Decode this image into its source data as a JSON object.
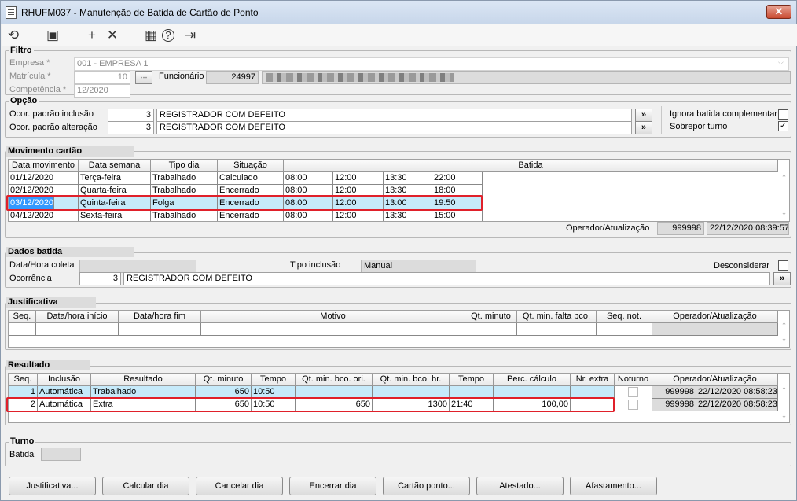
{
  "window": {
    "title": "RHUFM037 - Manutenção de Batida de Cartão de Ponto",
    "close_label": "✕"
  },
  "toolbar": {
    "refresh_icon": "⟲",
    "save_icon": "▣",
    "add_icon": "+",
    "delete_icon": "✕",
    "calendar_icon": "▦",
    "help_icon": "?",
    "exit_icon": "⇥"
  },
  "filtro": {
    "title": "Filtro",
    "empresa_label": "Empresa *",
    "empresa_value": "001 - EMPRESA 1",
    "matricula_label": "Matrícula *",
    "matricula_value": "10",
    "competencia_label": "Competência *",
    "competencia_value": "12/2020",
    "funcionario_label": "Funcionário",
    "funcionario_code": "24997"
  },
  "opcao": {
    "title": "Opção",
    "inclusao_label": "Ocor. padrão inclusão",
    "inclusao_code": "3",
    "inclusao_desc": "REGISTRADOR COM DEFEITO",
    "alteracao_label": "Ocor. padrão alteração",
    "alteracao_code": "3",
    "alteracao_desc": "REGISTRADOR COM DEFEITO",
    "lookup_label": "»",
    "ignora_label": "Ignora batida complementar",
    "ignora_checked": false,
    "sobrepor_label": "Sobrepor turno",
    "sobrepor_checked": true
  },
  "movimento": {
    "title": "Movimento cartão",
    "headers": [
      "Data movimento",
      "Data semana",
      "Tipo dia",
      "Situação",
      "Batida"
    ],
    "rows": [
      {
        "data": "01/12/2020",
        "semana": "Terça-feira",
        "tipo": "Trabalhado",
        "situacao": "Calculado",
        "batidas": [
          "08:00",
          "12:00",
          "13:30",
          "22:00"
        ]
      },
      {
        "data": "02/12/2020",
        "semana": "Quarta-feira",
        "tipo": "Trabalhado",
        "situacao": "Encerrado",
        "batidas": [
          "08:00",
          "12:00",
          "13:30",
          "18:00"
        ]
      },
      {
        "data": "03/12/2020",
        "semana": "Quinta-feira",
        "tipo": "Folga",
        "situacao": "Encerrado",
        "batidas": [
          "08:00",
          "12:00",
          "13:00",
          "19:50"
        ]
      },
      {
        "data": "04/12/2020",
        "semana": "Sexta-feira",
        "tipo": "Trabalhado",
        "situacao": "Encerrado",
        "batidas": [
          "08:00",
          "12:00",
          "13:30",
          "15:00"
        ]
      }
    ],
    "operador_label": "Operador/Atualização",
    "operador_value": "999998",
    "atualizacao_value": "22/12/2020 08:39:57"
  },
  "dados_batida": {
    "title": "Dados batida",
    "data_hora_label": "Data/Hora coleta",
    "data_hora_value": "",
    "tipo_inclusao_label": "Tipo inclusão",
    "tipo_inclusao_value": "Manual",
    "desconsiderar_label": "Desconsiderar",
    "desconsiderar_checked": false,
    "ocorrencia_label": "Ocorrência",
    "ocorrencia_code": "3",
    "ocorrencia_desc": "REGISTRADOR COM DEFEITO"
  },
  "justificativa": {
    "title": "Justificativa",
    "headers": [
      "Seq.",
      "Data/hora início",
      "Data/hora fim",
      "Motivo",
      "Qt. minuto",
      "Qt. min. falta bco.",
      "Seq. not.",
      "Operador/Atualização"
    ]
  },
  "resultado": {
    "title": "Resultado",
    "headers": [
      "Seq.",
      "Inclusão",
      "Resultado",
      "Qt. minuto",
      "Tempo",
      "Qt. min. bco. ori.",
      "Qt. min. bco. hr.",
      "Tempo",
      "Perc. cálculo",
      "Nr. extra",
      "Noturno",
      "Operador/Atualização"
    ],
    "rows": [
      {
        "seq": "1",
        "inclusao": "Automática",
        "resultado": "Trabalhado",
        "qt_minuto": "650",
        "tempo": "10:50",
        "bco_ori": "",
        "bco_hr": "",
        "tempo2": "",
        "perc": "",
        "nr_extra": "",
        "noturno": false,
        "operador": "999998",
        "atualizacao": "22/12/2020 08:58:23"
      },
      {
        "seq": "2",
        "inclusao": "Automática",
        "resultado": "Extra",
        "qt_minuto": "650",
        "tempo": "10:50",
        "bco_ori": "650",
        "bco_hr": "1300",
        "tempo2": "21:40",
        "perc": "100,00",
        "nr_extra": "",
        "noturno": false,
        "operador": "999998",
        "atualizacao": "22/12/2020 08:58:23"
      }
    ]
  },
  "turno": {
    "title": "Turno",
    "batida_label": "Batida",
    "batida_value": ""
  },
  "buttons": [
    "Justificativa...",
    "Calcular dia",
    "Cancelar dia",
    "Encerrar dia",
    "Cartão ponto...",
    "Atestado...",
    "Afastamento..."
  ]
}
